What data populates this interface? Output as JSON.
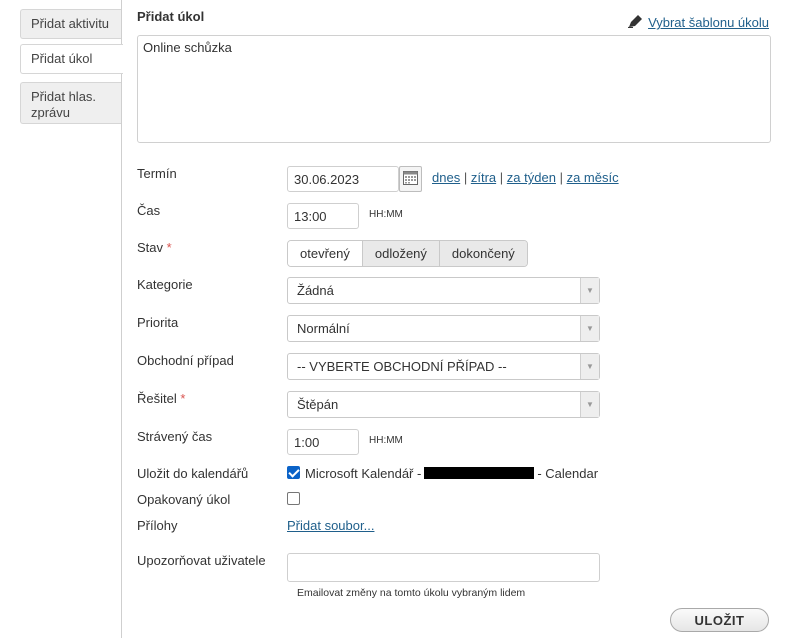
{
  "sidebar": {
    "tabs": [
      {
        "label": "Přidat aktivitu"
      },
      {
        "label": "Přidat úkol"
      },
      {
        "label": "Přidat hlas. zprávu"
      }
    ]
  },
  "form": {
    "heading": "Přidat úkol",
    "template_link": "Vybrat šablonu úkolu",
    "description": "Online schůzka",
    "fields": {
      "termin_label": "Termín",
      "termin_value": "30.06.2023",
      "quick_today": "dnes",
      "quick_tomorrow": "zítra",
      "quick_week": "za týden",
      "quick_month": "za měsíc",
      "separator": "|",
      "cas_label": "Čas",
      "cas_value": "13:00",
      "cas_hint": "HH:MM",
      "stav_label": "Stav",
      "required_mark": "*",
      "stav_options": [
        "otevřený",
        "odložený",
        "dokončený"
      ],
      "kategorie_label": "Kategorie",
      "kategorie_value": "Žádná",
      "priorita_label": "Priorita",
      "priorita_value": "Normální",
      "pripad_label": "Obchodní případ",
      "pripad_value": "-- VYBERTE OBCHODNÍ PŘÍPAD --",
      "resitel_label": "Řešitel",
      "resitel_value": "Štěpán",
      "straveny_label": "Strávený čas",
      "straveny_value": "1:00",
      "straveny_hint": "HH:MM",
      "kalendar_label": "Uložit do kalendářů",
      "kalendar_prefix": "Microsoft Kalendář -",
      "kalendar_suffix": "- Calendar",
      "kalendar_checked": true,
      "opakovany_label": "Opakovaný úkol",
      "opakovany_checked": false,
      "prilohy_label": "Přílohy",
      "prilohy_link": "Přidat soubor...",
      "upozornovat_label": "Upozorňovat uživatele",
      "upozornovat_hint": "Emailovat změny na tomto úkolu vybraným lidem"
    },
    "save_label": "ULOŽIT"
  }
}
